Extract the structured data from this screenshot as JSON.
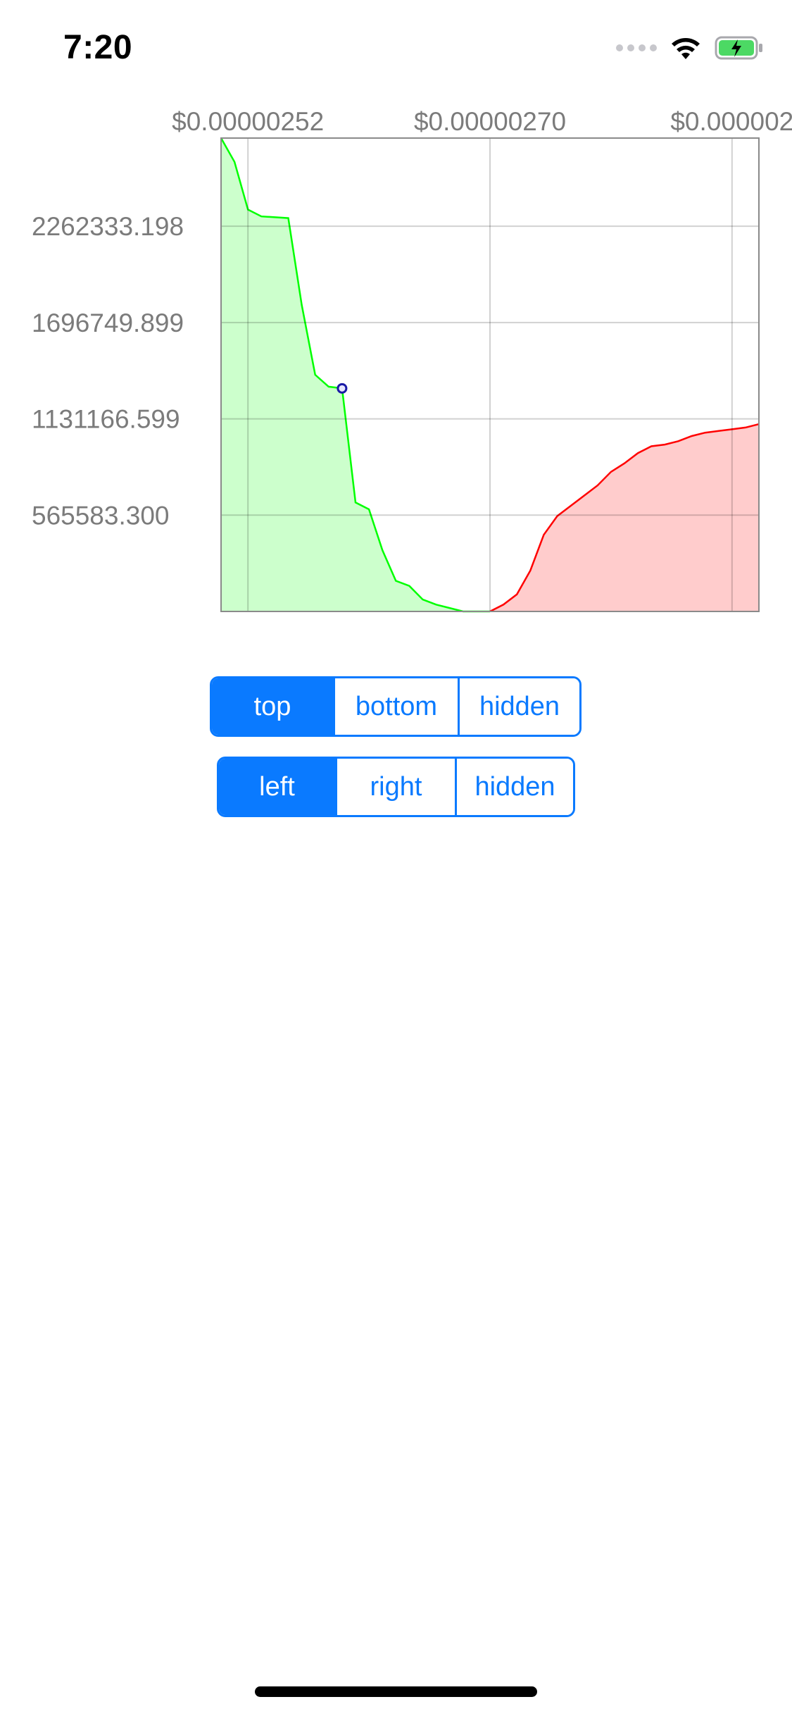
{
  "status_bar": {
    "time": "7:20",
    "icons": [
      "cellular-signal-icon",
      "wifi-icon",
      "battery-charging-icon"
    ],
    "battery_color": "#4cd964"
  },
  "chart_data": {
    "type": "area",
    "x_tick_labels": [
      "$0.00000252",
      "$0.00000270",
      "$0.000002"
    ],
    "y_tick_labels": [
      "2262333.198",
      "1696749.899",
      "1131166.599",
      "565583.300"
    ],
    "y_ticks": [
      2262333.198,
      1696749.899,
      1131166.599,
      565583.3
    ],
    "x_ticks": [
      2.52e-06,
      2.7e-06,
      2.88e-06
    ],
    "xlim": [
      2.5e-06,
      2.9e-06
    ],
    "ylim": [
      0,
      2780000
    ],
    "grid": true,
    "series": [
      {
        "color": "#00ff00",
        "fill": "#ccffcc",
        "x": [
          2.5e-06,
          2.51e-06,
          2.52e-06,
          2.53e-06,
          2.55e-06,
          2.56e-06,
          2.57e-06,
          2.58e-06,
          2.59e-06,
          2.59e-06,
          2.6e-06,
          2.61e-06,
          2.62e-06,
          2.63e-06,
          2.64e-06,
          2.65e-06,
          2.66e-06,
          2.68e-06,
          2.7e-06
        ],
        "values": [
          2780000,
          2640000,
          2360000,
          2320000,
          2310000,
          1800000,
          1390000,
          1320000,
          1310000,
          1310000,
          640000,
          600000,
          360000,
          180000,
          150000,
          70000,
          40000,
          0,
          0
        ]
      },
      {
        "color": "#ff0000",
        "fill": "#ffcccc",
        "x": [
          2.7e-06,
          2.71e-06,
          2.72e-06,
          2.73e-06,
          2.74e-06,
          2.75e-06,
          2.76e-06,
          2.77e-06,
          2.78e-06,
          2.79e-06,
          2.8e-06,
          2.81e-06,
          2.82e-06,
          2.83e-06,
          2.84e-06,
          2.85e-06,
          2.86e-06,
          2.87e-06,
          2.88e-06,
          2.89e-06,
          2.9e-06
        ],
        "values": [
          0,
          40000,
          100000,
          240000,
          450000,
          560000,
          620000,
          680000,
          740000,
          820000,
          870000,
          930000,
          970000,
          980000,
          1000000,
          1030000,
          1050000,
          1060000,
          1070000,
          1080000,
          1100000
        ]
      }
    ],
    "highlight": {
      "x": 2.59e-06,
      "y": 1310000,
      "color": "#1a1aa6"
    }
  },
  "controls": {
    "x_axis_position": {
      "options": [
        "top",
        "bottom",
        "hidden"
      ],
      "selected": "top"
    },
    "y_axis_position": {
      "options": [
        "left",
        "right",
        "hidden"
      ],
      "selected": "left"
    },
    "accent_color": "#0a7aff"
  }
}
